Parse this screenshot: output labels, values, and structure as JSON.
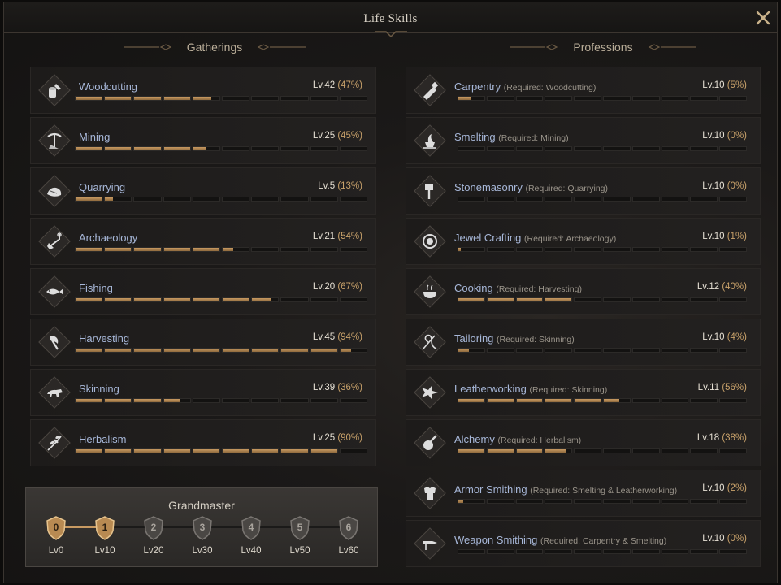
{
  "window": {
    "title": "Life Skills"
  },
  "columns": {
    "left_title": "Gatherings",
    "right_title": "Professions"
  },
  "gatherings": [
    {
      "name": "Woodcutting",
      "level": "Lv.42",
      "pct": "(47%)",
      "fill": 0.47,
      "icon": "woodcutting-icon"
    },
    {
      "name": "Mining",
      "level": "Lv.25",
      "pct": "(45%)",
      "fill": 0.45,
      "icon": "mining-icon"
    },
    {
      "name": "Quarrying",
      "level": "Lv.5",
      "pct": "(13%)",
      "fill": 0.13,
      "icon": "quarrying-icon"
    },
    {
      "name": "Archaeology",
      "level": "Lv.21",
      "pct": "(54%)",
      "fill": 0.54,
      "icon": "archaeology-icon"
    },
    {
      "name": "Fishing",
      "level": "Lv.20",
      "pct": "(67%)",
      "fill": 0.67,
      "icon": "fishing-icon"
    },
    {
      "name": "Harvesting",
      "level": "Lv.45",
      "pct": "(94%)",
      "fill": 0.94,
      "icon": "harvesting-icon"
    },
    {
      "name": "Skinning",
      "level": "Lv.39",
      "pct": "(36%)",
      "fill": 0.36,
      "icon": "skinning-icon"
    },
    {
      "name": "Herbalism",
      "level": "Lv.25",
      "pct": "(90%)",
      "fill": 0.9,
      "icon": "herbalism-icon"
    }
  ],
  "professions": [
    {
      "name": "Carpentry",
      "req": "(Required: Woodcutting)",
      "level": "Lv.10",
      "pct": "(5%)",
      "fill": 0.05,
      "icon": "carpentry-icon"
    },
    {
      "name": "Smelting",
      "req": "(Required: Mining)",
      "level": "Lv.10",
      "pct": "(0%)",
      "fill": 0.0,
      "icon": "smelting-icon"
    },
    {
      "name": "Stonemasonry",
      "req": "(Required: Quarrying)",
      "level": "Lv.10",
      "pct": "(0%)",
      "fill": 0.0,
      "icon": "stonemasonry-icon"
    },
    {
      "name": "Jewel Crafting",
      "req": "(Required: Archaeology)",
      "level": "Lv.10",
      "pct": "(1%)",
      "fill": 0.01,
      "icon": "jewel-crafting-icon"
    },
    {
      "name": "Cooking",
      "req": "(Required: Harvesting)",
      "level": "Lv.12",
      "pct": "(40%)",
      "fill": 0.4,
      "icon": "cooking-icon"
    },
    {
      "name": "Tailoring",
      "req": "(Required: Skinning)",
      "level": "Lv.10",
      "pct": "(4%)",
      "fill": 0.04,
      "icon": "tailoring-icon"
    },
    {
      "name": "Leatherworking",
      "req": "(Required: Skinning)",
      "level": "Lv.11",
      "pct": "(56%)",
      "fill": 0.56,
      "icon": "leatherworking-icon"
    },
    {
      "name": "Alchemy",
      "req": "(Required: Herbalism)",
      "level": "Lv.18",
      "pct": "(38%)",
      "fill": 0.38,
      "icon": "alchemy-icon"
    },
    {
      "name": "Armor Smithing",
      "req": "(Required: Smelting & Leatherworking)",
      "level": "Lv.10",
      "pct": "(2%)",
      "fill": 0.02,
      "icon": "armor-smithing-icon"
    },
    {
      "name": "Weapon Smithing",
      "req": "(Required: Carpentry & Smelting)",
      "level": "Lv.10",
      "pct": "(0%)",
      "fill": 0.0,
      "icon": "weapon-smithing-icon"
    }
  ],
  "grandmaster": {
    "title": "Grandmaster",
    "progress": 0.17,
    "tiers": [
      {
        "num": "0",
        "label": "Lv0",
        "achieved": true
      },
      {
        "num": "1",
        "label": "Lv10",
        "achieved": true
      },
      {
        "num": "2",
        "label": "Lv20",
        "achieved": false
      },
      {
        "num": "3",
        "label": "Lv30",
        "achieved": false
      },
      {
        "num": "4",
        "label": "Lv40",
        "achieved": false
      },
      {
        "num": "5",
        "label": "Lv50",
        "achieved": false
      },
      {
        "num": "6",
        "label": "Lv60",
        "achieved": false
      }
    ]
  },
  "colors": {
    "accent": "#c89a62",
    "name_text": "#a7b7d8",
    "level_text": "#e6e0d4"
  }
}
